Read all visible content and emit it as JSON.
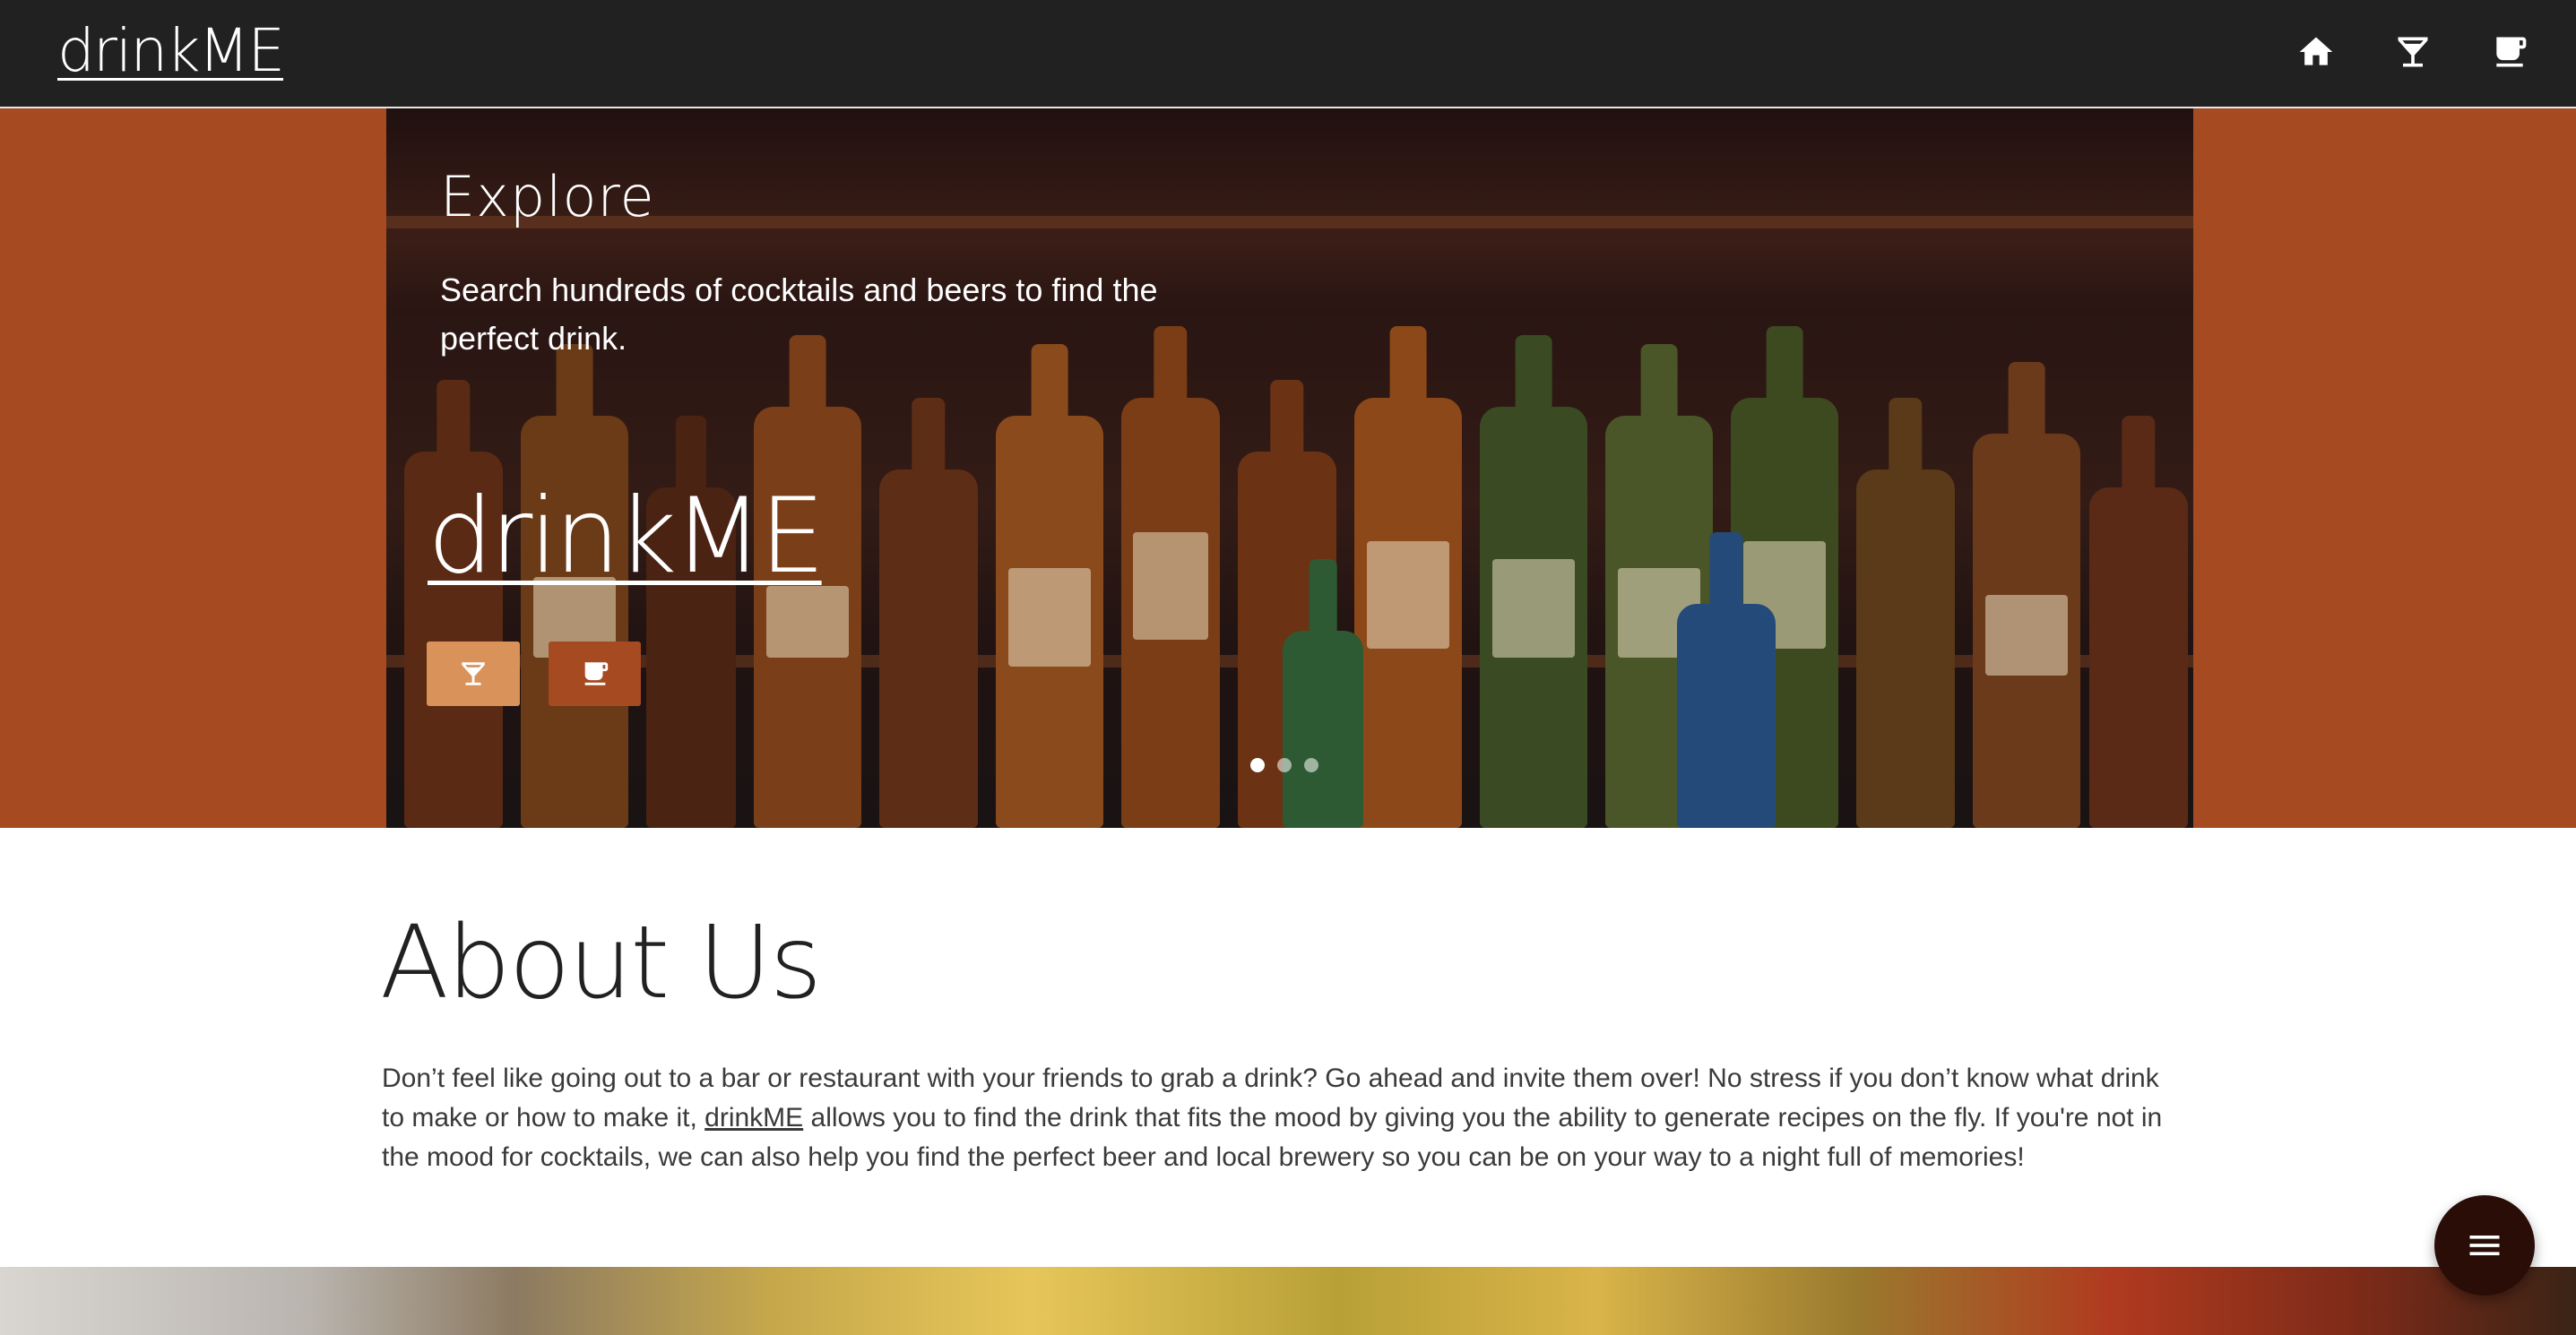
{
  "navbar": {
    "brand": "drinkME",
    "icons": [
      "home-icon",
      "cocktail-icon",
      "beer-mug-icon"
    ]
  },
  "hero": {
    "title": "Explore",
    "text": "Search hundreds of cocktails and beers to find the perfect drink.",
    "brand": "drinkME",
    "buttons": [
      "cocktail-icon",
      "beer-mug-icon"
    ],
    "carousel": {
      "slides": 3,
      "active": 1
    }
  },
  "about": {
    "title": "About Us",
    "text_before_link": "Don’t feel like going out to a bar or restaurant with your friends to grab a drink? Go ahead and invite them over! No stress if you don’t know what drink to make or how to make it, ",
    "link": "drinkME",
    "text_after_link": " allows you to find the drink that fits the mood by giving you the ability to generate recipes on the fly. If you're not in the mood for cocktails, we can also help you find the perfect beer and local brewery so you can be on your way to a night full of memories!"
  },
  "fab": {
    "icon": "menu-icon"
  },
  "colors": {
    "navbar": "#212121",
    "hero_band": "#a64a22",
    "cocktail_button": "#d9925a",
    "beer_button": "#a64a22",
    "fab": "#2a0d07"
  }
}
